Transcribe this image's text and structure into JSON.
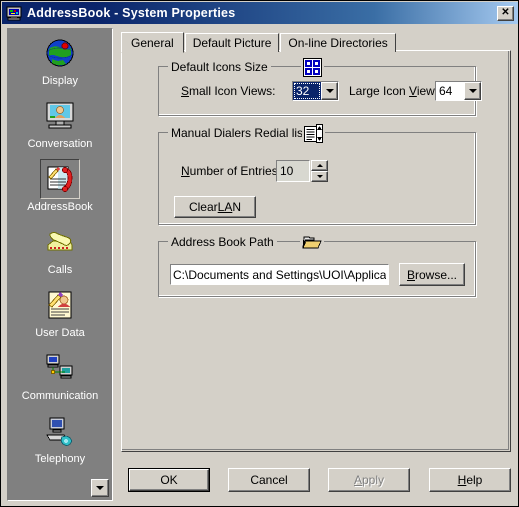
{
  "window": {
    "title": "AddressBook - System Properties",
    "icon": "monitor-display-icon",
    "close_label": "✕",
    "titlebar_color_left": "#0a246a",
    "titlebar_color_right": "#a6caf0",
    "face_color": "#d4d0c8"
  },
  "sidebar": {
    "background": "#808080",
    "scroll_down_label": "",
    "items": [
      {
        "label": "Display",
        "icon": "globe-icon",
        "selected": false
      },
      {
        "label": "Conversation",
        "icon": "monitor-person-icon",
        "selected": false
      },
      {
        "label": "AddressBook",
        "icon": "addressbook-phone-icon",
        "selected": true
      },
      {
        "label": "Calls",
        "icon": "telephone-icon",
        "selected": false
      },
      {
        "label": "User Data",
        "icon": "notepad-person-icon",
        "selected": false
      },
      {
        "label": "Communication",
        "icon": "network-computers-icon",
        "selected": false
      },
      {
        "label": "Telephony",
        "icon": "computer-phone-icon",
        "selected": false
      }
    ]
  },
  "tabs": [
    {
      "label": "General",
      "active": true
    },
    {
      "label": "Default Picture",
      "active": false
    },
    {
      "label": "On-line Directories",
      "active": false
    }
  ],
  "general": {
    "icons_size_group": {
      "title": "Default Icons Size",
      "icon": "icon-grid-icon",
      "small_label_pre": "S",
      "small_label_post": "mall Icon Views:",
      "small_value": "32",
      "large_label_pre": "Large Icon ",
      "large_label_accel": "V",
      "large_label_post": "iew:",
      "large_value": "64"
    },
    "redial_group": {
      "title": "Manual Dialers Redial list",
      "icon": "list-spinner-icon",
      "entries_label_accel": "N",
      "entries_label_post": "umber of Entries",
      "entries_value": "10",
      "clear_button_pre": "Clear ",
      "clear_button_accel": "LA",
      "clear_button_post": "N"
    },
    "path_group": {
      "title": "Address Book Path",
      "icon": "folder-icon",
      "path_value": "C:\\Documents and Settings\\UOI\\Application",
      "browse_pre": "",
      "browse_accel": "B",
      "browse_post": "rowse..."
    }
  },
  "footer": {
    "ok": "OK",
    "cancel": "Cancel",
    "apply": "Apply",
    "apply_accel": "A",
    "apply_post": "pply",
    "help_accel": "H",
    "help_post": "elp"
  }
}
